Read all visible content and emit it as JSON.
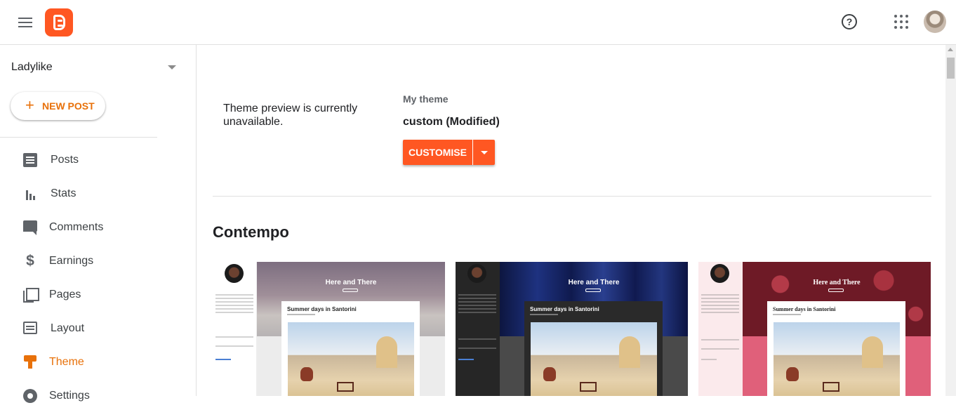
{
  "header": {
    "menu_icon": "hamburger-menu-icon",
    "logo_icon": "blogger-logo-icon",
    "help_icon": "help-icon",
    "apps_icon": "apps-grid-icon",
    "help_glyph": "?"
  },
  "sidebar": {
    "blog_name": "Ladylike",
    "new_post_label": "NEW POST",
    "new_post_glyph": "+",
    "items": [
      {
        "label": "Posts",
        "icon": "posts-icon"
      },
      {
        "label": "Stats",
        "icon": "stats-icon"
      },
      {
        "label": "Comments",
        "icon": "comments-icon"
      },
      {
        "label": "Earnings",
        "icon": "dollar-icon",
        "glyph": "$"
      },
      {
        "label": "Pages",
        "icon": "pages-icon"
      },
      {
        "label": "Layout",
        "icon": "layout-icon"
      },
      {
        "label": "Theme",
        "icon": "theme-icon",
        "active": true
      },
      {
        "label": "Settings",
        "icon": "settings-icon"
      }
    ]
  },
  "main": {
    "preview_message": "Theme preview is currently unavailable.",
    "my_theme_label": "My theme",
    "theme_name": "custom (Modified)",
    "customise_label": "CUSTOMISE",
    "section_title": "Contempo",
    "cards": [
      {
        "title": "Here and There",
        "post_title": "Summer days in Santorini"
      },
      {
        "title": "Here and There",
        "post_title": "Summer days in Santorini"
      },
      {
        "title": "Here and There",
        "post_title": "Summer days in Santorini"
      }
    ]
  },
  "colors": {
    "accent": "#e8710a",
    "button": "#ff5722",
    "card_light_hero": "#8a7a88",
    "card_dark_hero": "#1b2a66",
    "card_pink_hero": "#7a1f2b"
  }
}
